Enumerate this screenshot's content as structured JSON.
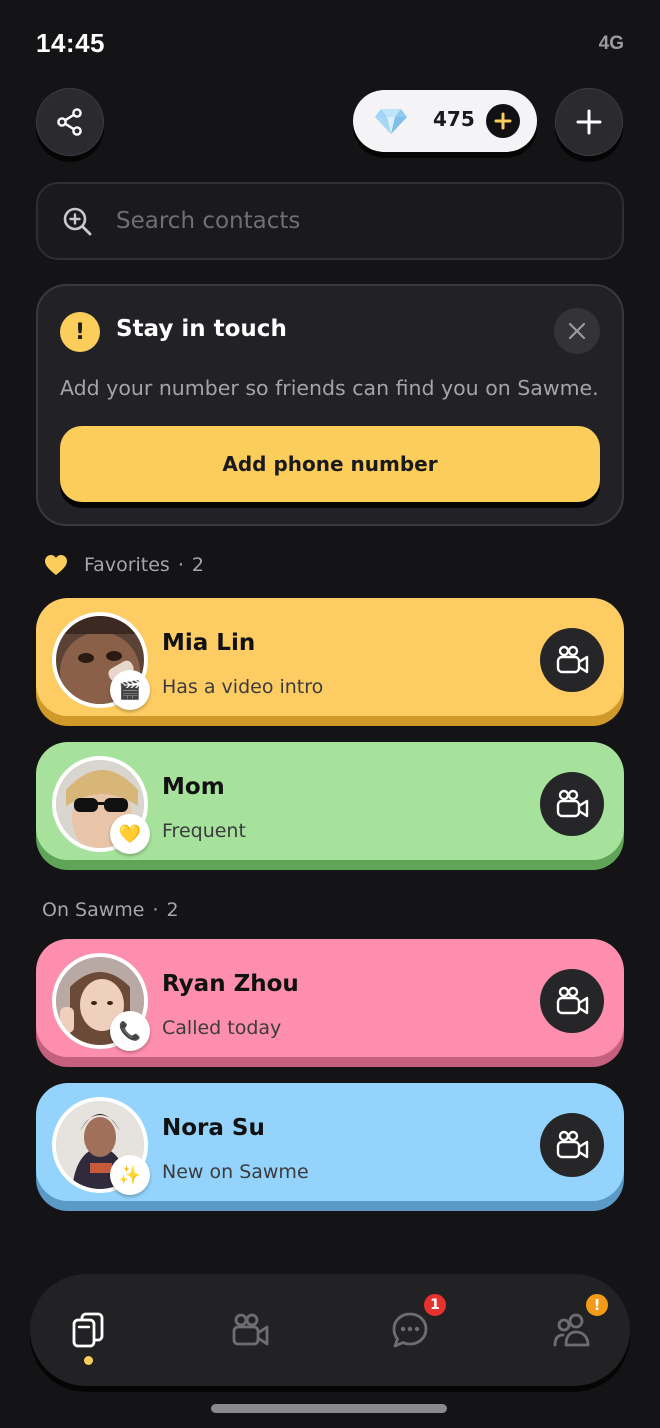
{
  "status_bar": {
    "time": "14:45",
    "network": "4G"
  },
  "header": {
    "gem_count": "475",
    "share_icon": "share-icon",
    "add_icon": "plus-icon"
  },
  "search": {
    "placeholder": "Search contacts",
    "value": ""
  },
  "banner": {
    "title": "Stay in touch",
    "text": "Add your number so friends can find you on Sawme.",
    "button_label": "Add phone number",
    "warn_glyph": "!"
  },
  "favorites": {
    "label": "Favorites",
    "separator": "·",
    "count": "2",
    "contacts": [
      {
        "name": "Mia Lin",
        "status": "Has a video intro",
        "color": "#fdcc62",
        "badge": "🎬"
      },
      {
        "name": "Mom",
        "status": "Frequent",
        "color": "#a6e29b",
        "badge": "💛"
      }
    ]
  },
  "on_sawme": {
    "label": "On Sawme",
    "separator": "·",
    "count": "2",
    "contacts": [
      {
        "name": "Ryan Zhou",
        "status": "Called today",
        "color": "#fd8eae",
        "badge": "📞"
      },
      {
        "name": "Nora Su",
        "status": "New on Sawme",
        "color": "#94d3fb",
        "badge": "✨"
      }
    ]
  },
  "nav": {
    "items": [
      "home",
      "video",
      "chat",
      "friends"
    ],
    "chat_badge": "1",
    "friends_badge": "!"
  },
  "colors": {
    "accent": "#fbcd5a",
    "background": "#141416"
  }
}
